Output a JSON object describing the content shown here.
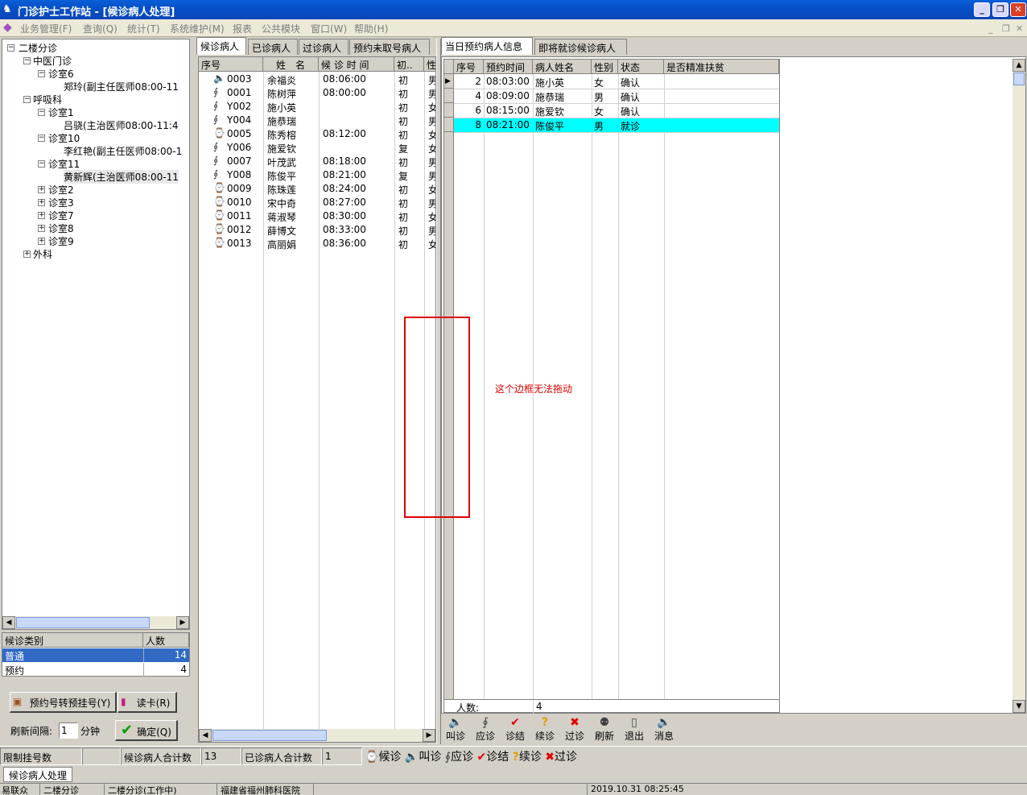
{
  "window": {
    "title": "门诊护士工作站 - [候诊病人处理]",
    "min_label": "_",
    "restore_label": "❐",
    "close_label": "✕"
  },
  "menu": [
    "业务管理(F)",
    "查询(Q)",
    "统计(T)",
    "系统维护(M)",
    "报表",
    "公共模块",
    "窗口(W)",
    "帮助(H)"
  ],
  "mdi": {
    "min": "_",
    "restore": "❐",
    "close": "✕"
  },
  "tree": {
    "root": "二楼分诊",
    "dept1": "中医门诊",
    "room6": "诊室6",
    "doctor1": "郑玲(副主任医师08:00-11",
    "dept2": "呼吸科",
    "room1": "诊室1",
    "doctor2": "吕骁(主治医师08:00-11:4",
    "room10": "诊室10",
    "doctor3": "李红艳(副主任医师08:00-1",
    "room11": "诊室11",
    "doctor4": "黄新辉(主治医师08:00-11",
    "room2": "诊室2",
    "room3": "诊室3",
    "room7": "诊室7",
    "room8": "诊室8",
    "room9": "诊室9",
    "dept3": "外科"
  },
  "category": {
    "headers": [
      "候诊类别",
      "人数"
    ],
    "rows": [
      {
        "name": "普通",
        "count": "14"
      },
      {
        "name": "预约",
        "count": "4"
      }
    ]
  },
  "left_buttons": {
    "convert": "预约号转预挂号(Y)",
    "read_card": "读卡(R)",
    "refresh_label": "刷新间隔:",
    "refresh_value": "1",
    "minute": "分钟",
    "confirm": "确定(Q)"
  },
  "tabs_left": [
    "候诊病人",
    "已诊病人",
    "过诊病人",
    "预约未取号病人"
  ],
  "wait_headers": [
    "序号",
    "姓　名",
    "候 诊 时 间",
    "初..",
    "性"
  ],
  "wait_rows": [
    {
      "icon": "call",
      "no": "0003",
      "name": "余福炎",
      "time": "08:06:00",
      "type": "初",
      "sex": "男"
    },
    {
      "icon": "answer",
      "no": "0001",
      "name": "陈树萍",
      "time": "08:00:00",
      "type": "初",
      "sex": "男"
    },
    {
      "icon": "answer",
      "no": "Y002",
      "name": "施小英",
      "time": "",
      "type": "初",
      "sex": "女"
    },
    {
      "icon": "answer",
      "no": "Y004",
      "name": "施恭瑞",
      "time": "",
      "type": "初",
      "sex": "男"
    },
    {
      "icon": "wait",
      "no": "0005",
      "name": "陈秀榕",
      "time": "08:12:00",
      "type": "初",
      "sex": "女"
    },
    {
      "icon": "answer",
      "no": "Y006",
      "name": "施爱钦",
      "time": "",
      "type": "复",
      "sex": "女"
    },
    {
      "icon": "answer",
      "no": "0007",
      "name": "叶茂武",
      "time": "08:18:00",
      "type": "初",
      "sex": "男"
    },
    {
      "icon": "answer",
      "no": "Y008",
      "name": "陈俊平",
      "time": "08:21:00",
      "type": "复",
      "sex": "男"
    },
    {
      "icon": "wait",
      "no": "0009",
      "name": "陈珠莲",
      "time": "08:24:00",
      "type": "初",
      "sex": "女"
    },
    {
      "icon": "wait",
      "no": "0010",
      "name": "宋中奇",
      "time": "08:27:00",
      "type": "初",
      "sex": "男"
    },
    {
      "icon": "wait",
      "no": "0011",
      "name": "蒋淑琴",
      "time": "08:30:00",
      "type": "初",
      "sex": "女"
    },
    {
      "icon": "wait",
      "no": "0012",
      "name": "薛博文",
      "time": "08:33:00",
      "type": "初",
      "sex": "男"
    },
    {
      "icon": "wait",
      "no": "0013",
      "name": "高丽娟",
      "time": "08:36:00",
      "type": "初",
      "sex": "女"
    }
  ],
  "tabs_right": [
    "当日预约病人信息",
    "即将就诊候诊病人"
  ],
  "appt_headers": [
    "序号",
    "预约时间",
    "病人姓名",
    "性别",
    "状态",
    "是否精准扶贫"
  ],
  "appt_rows": [
    {
      "no": "2",
      "time": "08:03:00",
      "name": "施小英",
      "sex": "女",
      "status": "确认",
      "poverty": ""
    },
    {
      "no": "4",
      "time": "08:09:00",
      "name": "施恭瑞",
      "sex": "男",
      "status": "确认",
      "poverty": ""
    },
    {
      "no": "6",
      "time": "08:15:00",
      "name": "施爱钦",
      "sex": "女",
      "status": "确认",
      "poverty": ""
    },
    {
      "no": "8",
      "time": "08:21:00",
      "name": "陈俊平",
      "sex": "男",
      "status": "就诊",
      "poverty": ""
    }
  ],
  "appt_footer": {
    "label": "人数:",
    "value": "4"
  },
  "annotation": "这个边框无法拖动",
  "toolbar": [
    "叫诊",
    "应诊",
    "诊结",
    "续诊",
    "过诊",
    "刷新",
    "退出",
    "消息"
  ],
  "status_row": {
    "limit": "限制挂号数",
    "limit_val": "",
    "wait_total": "候诊病人合计数",
    "wait_val": "13",
    "done_total": "已诊病人合计数",
    "done_val": "1"
  },
  "legend": [
    "候诊",
    "叫诊",
    "应诊",
    "诊结",
    "续诊",
    "过诊"
  ],
  "window_tab": "候诊病人处理",
  "statusbar": [
    "易联众",
    "二楼分诊",
    "二楼分诊(工作中)",
    "福建省福州肺科医院",
    "",
    "2019.10.31 08:25:45"
  ],
  "colors": {
    "selected_row": "#00ffff",
    "category_selected": "#316ac5",
    "annotation": "#e00000"
  }
}
